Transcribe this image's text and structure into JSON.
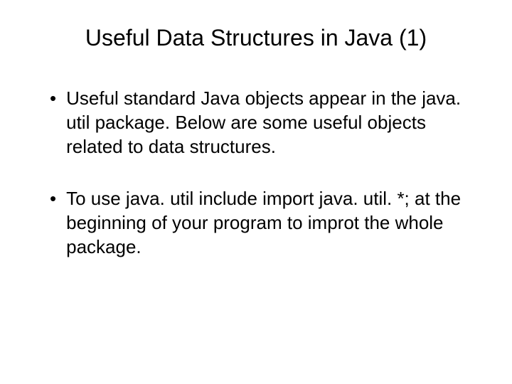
{
  "slide": {
    "title": "Useful Data Structures in Java (1)",
    "bullets": [
      "Useful standard Java objects appear in the java. util package. Below are some useful objects related to data structures.",
      "To use java. util include import java. util. *; at the beginning of your program to improt the whole package."
    ]
  }
}
